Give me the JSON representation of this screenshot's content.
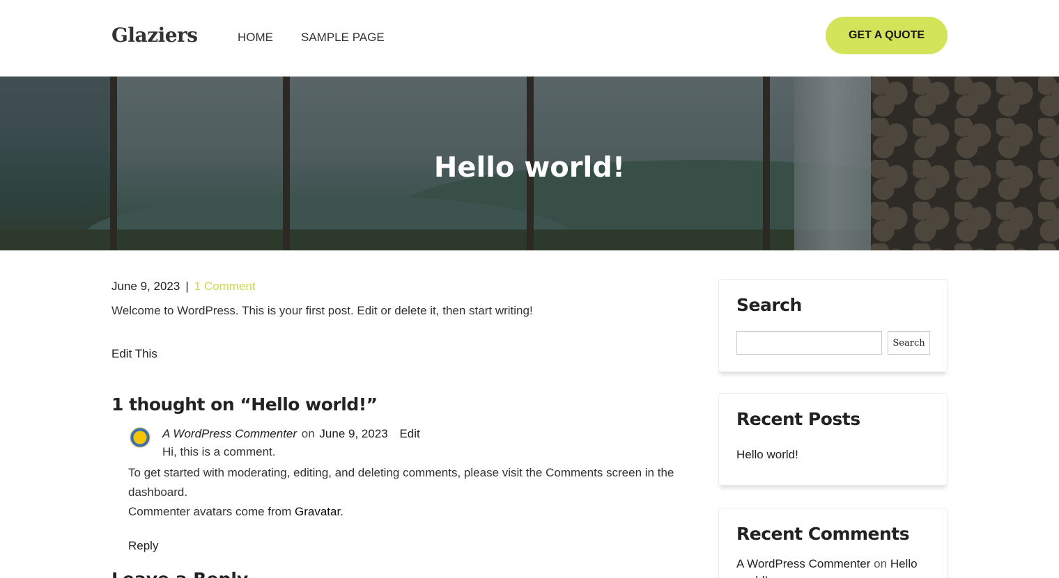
{
  "site": {
    "logo": "Glaziers"
  },
  "nav": {
    "items": [
      "HOME",
      "SAMPLE PAGE"
    ]
  },
  "header": {
    "cta_label": "GET A QUOTE"
  },
  "hero": {
    "title": "Hello world!"
  },
  "post": {
    "date": "June 9, 2023",
    "separator": "|",
    "comments_link": "1 Comment",
    "excerpt": "Welcome to WordPress. This is your first post. Edit or delete it, then start writing!",
    "edit_label": "Edit This"
  },
  "comments": {
    "title": "1 thought on “Hello world!”",
    "items": [
      {
        "author": "A WordPress Commenter",
        "on": "on",
        "date": "June 9, 2023",
        "edit": "Edit",
        "line1": "Hi, this is a comment.",
        "line2": "To get started with moderating, editing, and deleting comments, please visit the Comments screen in the dashboard.",
        "line3_prefix": "Commenter avatars come from ",
        "line3_link": "Gravatar",
        "line3_suffix": ".",
        "reply": "Reply"
      }
    ],
    "leave_reply": "Leave a Reply"
  },
  "sidebar": {
    "search": {
      "title": "Search",
      "button": "Search",
      "value": ""
    },
    "recent_posts": {
      "title": "Recent Posts",
      "items": [
        "Hello world!"
      ]
    },
    "recent_comments": {
      "title": "Recent Comments",
      "author": "A WordPress Commenter",
      "on": "on",
      "post": "Hello world!"
    }
  },
  "colors": {
    "accent": "#d3e35a",
    "link_accent": "#c9d94e"
  }
}
